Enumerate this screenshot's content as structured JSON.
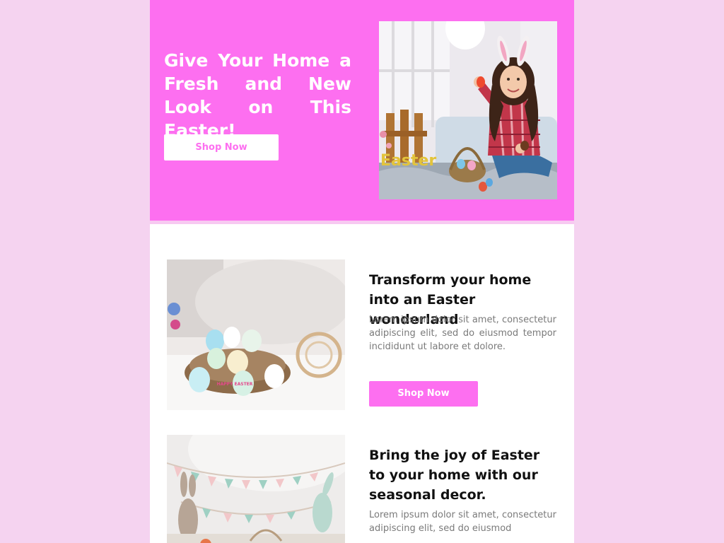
{
  "hero": {
    "title": "Give Your Home a Fresh and New Look on This Easter!",
    "button_label": "Shop Now",
    "photo_text": "Easter"
  },
  "rows": [
    {
      "title": "Transform your home into an Easter wonderland",
      "text": "Lorem ipsum dolor sit amet, consectetur adipiscing elit, sed do eiusmod tempor incididunt ut labore et dolore.",
      "button_label": "Shop Now",
      "egg_text": "HAPPY EASTER"
    },
    {
      "title": "Bring the joy of Easter to your home with our seasonal decor.",
      "text": "Lorem ipsum dolor sit amet, consectetur adipiscing elit, sed do eiusmod"
    }
  ],
  "colors": {
    "page_background": "#f5d3f0",
    "brand_pink": "#fd6ff0",
    "content_background": "#ffffff",
    "heading": "#111111",
    "body_text": "#7a7a7a"
  }
}
